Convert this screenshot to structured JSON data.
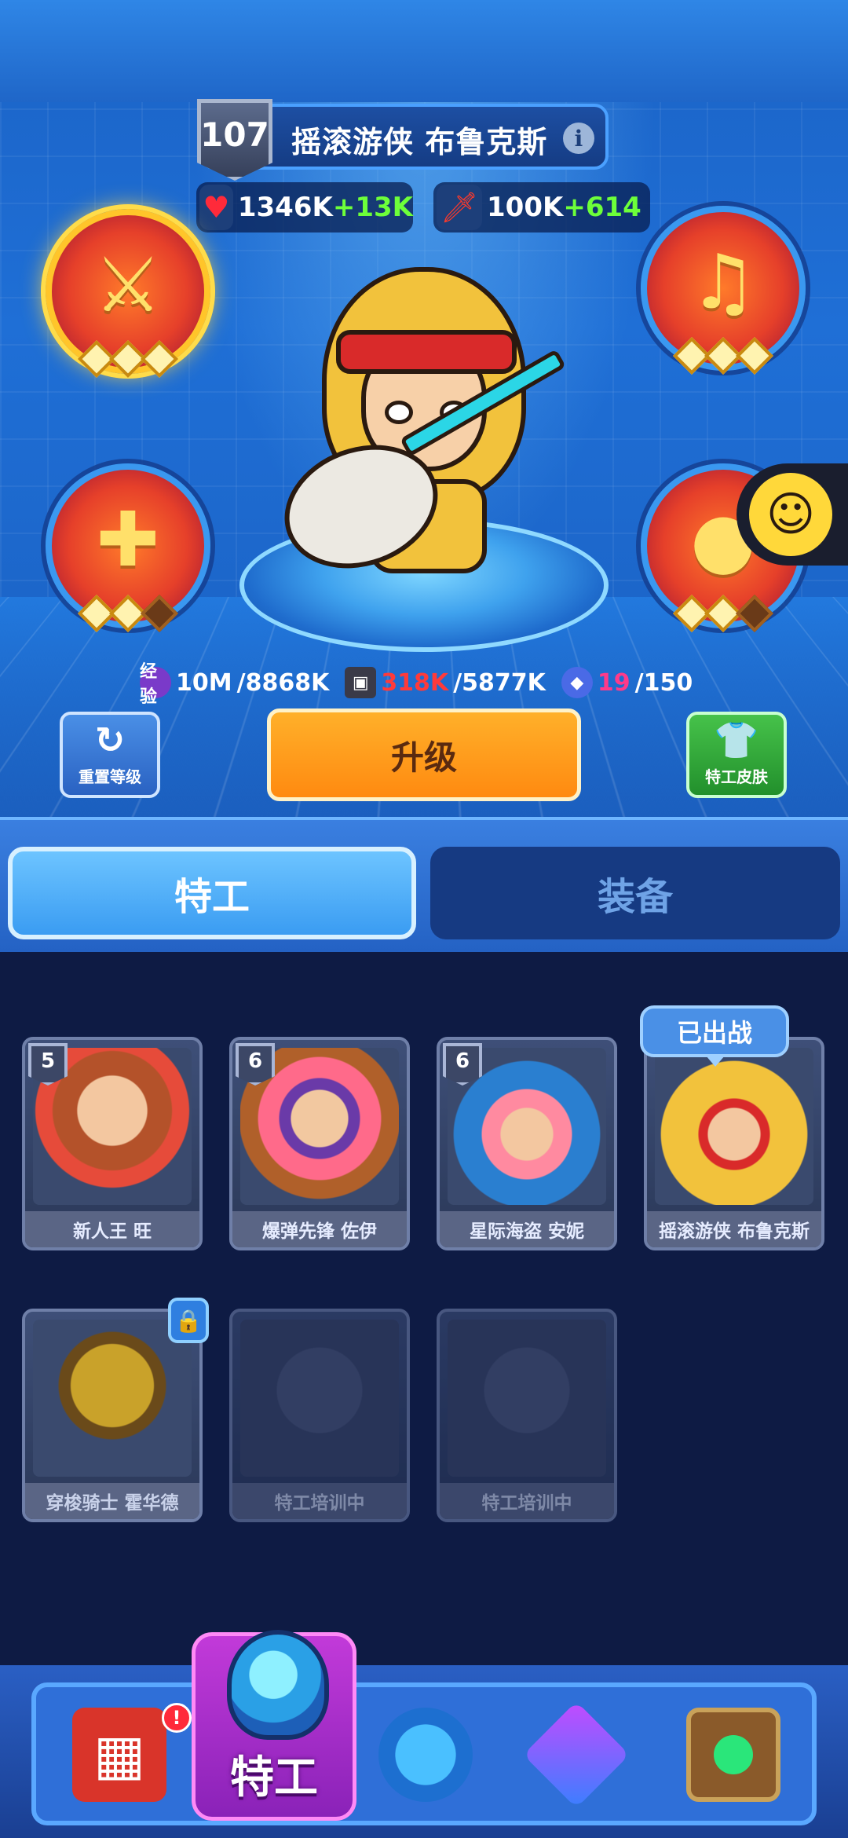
{
  "hero": {
    "level": "107",
    "name": "摇滚游侠 布鲁克斯",
    "hp": "1346K",
    "hp_plus": "+13K",
    "atk": "100K",
    "atk_plus": "+614",
    "skills": [
      {
        "icon": "sword-icon",
        "active": true,
        "stars_on": 3
      },
      {
        "icon": "music-notes-icon",
        "active": false,
        "stars_on": 3
      },
      {
        "icon": "heal-crystal-icon",
        "active": false,
        "stars_on": 2
      },
      {
        "icon": "coin-burst-icon",
        "active": false,
        "stars_on": 2
      }
    ]
  },
  "resources": {
    "exp_icon_label": "经验",
    "exp_have": "10M",
    "exp_need": "/8868K",
    "tape_have": "318K",
    "tape_need": "/5877K",
    "gem_have": "19",
    "gem_need": "/150"
  },
  "actions": {
    "reset_label": "重置等级",
    "upgrade_label": "升级",
    "skin_label": "特工皮肤"
  },
  "tabs": [
    {
      "label": "特工",
      "active": true
    },
    {
      "label": "装备",
      "active": false
    }
  ],
  "roster": {
    "deployed_tag": "已出战",
    "cards": [
      {
        "name": "新人王 旺",
        "level": "5"
      },
      {
        "name": "爆弹先锋 佐伊",
        "level": "6"
      },
      {
        "name": "星际海盗 安妮",
        "level": "6"
      },
      {
        "name": "摇滚游侠 布鲁克斯",
        "level": ""
      },
      {
        "name": "穿梭骑士 霍华德",
        "level": "",
        "locked": true
      },
      {
        "name": "特工培训中",
        "level": "",
        "training": true
      },
      {
        "name": "特工培训中",
        "level": "",
        "training": true
      }
    ]
  },
  "bottom_nav": {
    "active_label": "特工",
    "alert": "!",
    "items": [
      "shop-machine-icon",
      "agent-helmet-icon",
      "planet-icon",
      "cube-icon",
      "portal-icon"
    ]
  },
  "colors": {
    "upgrade": "#ff9a14",
    "plus_green": "#6dff3a",
    "warning_red": "#ff3a3a"
  }
}
